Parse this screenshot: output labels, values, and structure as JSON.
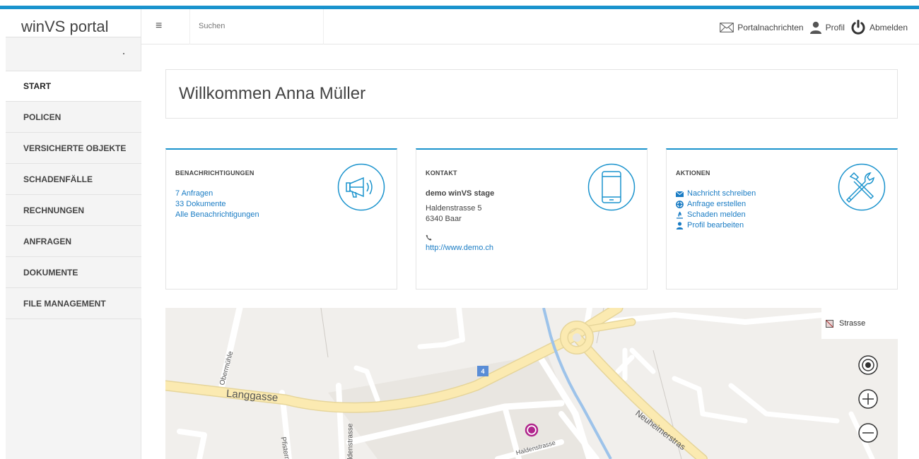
{
  "brand": {
    "name": "winVS portal"
  },
  "header": {
    "menu_glyph": "≡",
    "search_placeholder": "Suchen",
    "nav": {
      "messages": "Portalnachrichten",
      "profile": "Profil",
      "logout": "Abmelden"
    }
  },
  "sidebar": {
    "items": [
      {
        "label": "START",
        "active": true
      },
      {
        "label": "POLICEN"
      },
      {
        "label": "VERSICHERTE OBJEKTE"
      },
      {
        "label": "SCHADENFÄLLE"
      },
      {
        "label": "RECHNUNGEN"
      },
      {
        "label": "ANFRAGEN"
      },
      {
        "label": "DOKUMENTE"
      },
      {
        "label": "FILE MANAGEMENT"
      }
    ]
  },
  "welcome": {
    "title": "Willkommen Anna Müller"
  },
  "cards": {
    "notifications": {
      "title": "BENACHRICHTIGUNGEN",
      "icon": "megaphone-icon",
      "requests": "7 Anfragen",
      "documents": "33 Dokumente",
      "all": "Alle Benachrichtigungen"
    },
    "contact": {
      "title": "KONTAKT",
      "icon": "mobile-phone-icon",
      "company": "demo winVS stage",
      "street": "Haldenstrasse 5",
      "city": "6340 Baar",
      "website": "http://www.demo.ch"
    },
    "actions": {
      "title": "AKTIONEN",
      "icon": "tools-icon",
      "write_message": "Nachricht schreiben",
      "create_request": "Anfrage erstellen",
      "report_damage": "Schaden melden",
      "edit_profile": "Profil bearbeiten"
    }
  },
  "map": {
    "legend": "Strasse",
    "legend_mark": "·",
    "route_badge": "4",
    "streets": {
      "langgasse": "Langgasse",
      "obermuehle": "Obermühle",
      "pfistern": "Pfistern",
      "haldenstrasse_v": "Haldenstrasse",
      "haldenstrasse": "Haldenstrasse",
      "neuheimer": "Neuheimerstras"
    }
  },
  "colors": {
    "accent": "#1a93cd",
    "link": "#1a7cc4",
    "marker": "#b0258c"
  }
}
